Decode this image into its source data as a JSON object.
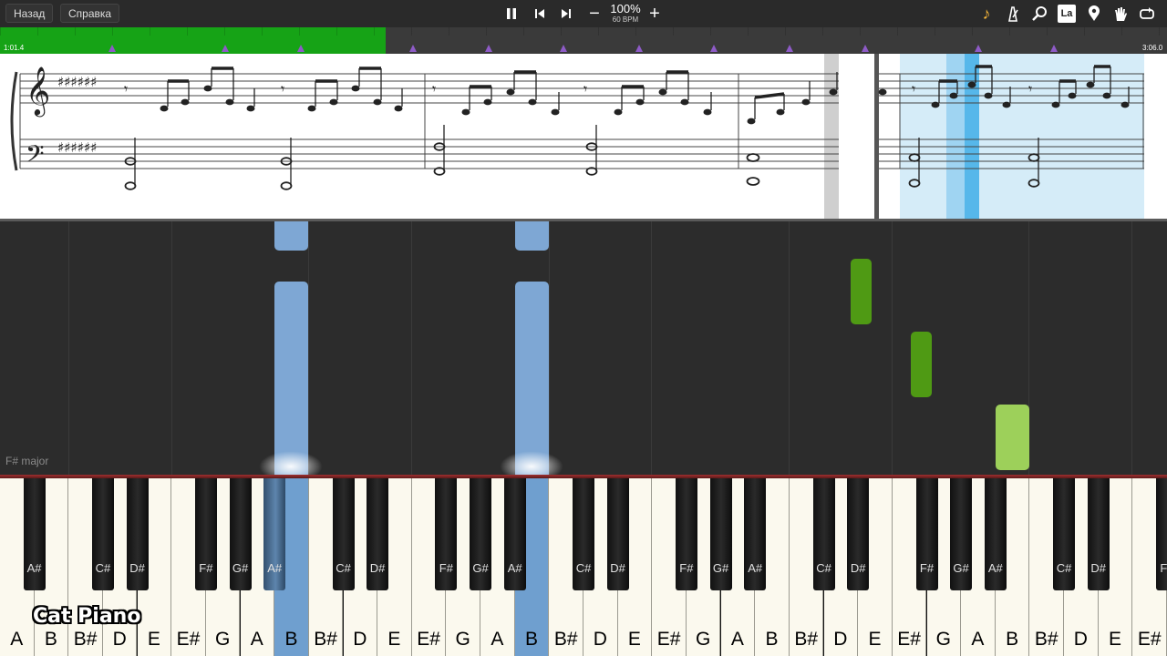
{
  "toolbar": {
    "back_label": "Назад",
    "help_label": "Справка",
    "pause_icon": "pause-icon",
    "prev_icon": "skip-back-icon",
    "next_icon": "skip-forward-icon",
    "tempo_down": "−",
    "tempo_up": "+",
    "tempo_percent": "100%",
    "tempo_bpm": "60 BPM",
    "right_icons": [
      "music-note-icon",
      "metronome-icon",
      "magnifier-icon",
      "note-label-icon",
      "location-pin-icon",
      "hand-icon",
      "loop-icon"
    ],
    "la_label": "La"
  },
  "timeline": {
    "current_time": "1:01.4",
    "total_time": "3:06.0",
    "progress_fraction": 0.33,
    "played_color": "#16a316",
    "marker_color": "#8e5bc7"
  },
  "piano_roll": {
    "key_label": "F# major",
    "left_hand_color": "#7ea7d4",
    "right_hand_color": "#4f9a14",
    "right_hand_light": "#9dd05a"
  },
  "keyboard": {
    "white_keys": [
      "A",
      "B",
      "B#",
      "D",
      "E",
      "E#",
      "G",
      "A",
      "B",
      "B#",
      "D",
      "E",
      "E#",
      "G",
      "A",
      "B",
      "B#",
      "D",
      "E",
      "E#",
      "G",
      "A",
      "B",
      "B#",
      "D",
      "E",
      "E#",
      "G",
      "A",
      "B",
      "B#",
      "D",
      "E",
      "E#"
    ],
    "black_keys": [
      "A#",
      "C#",
      "D#",
      "F#",
      "G#",
      "A#",
      "C#",
      "D#",
      "F#",
      "G#",
      "A#",
      "C#",
      "D#",
      "F#",
      "G#",
      "A#",
      "C#",
      "D#",
      "F#",
      "G#",
      "A#",
      "C#",
      "D#",
      "F#"
    ],
    "active_color": "#6f9fcf"
  },
  "watermark": "Cat Piano"
}
